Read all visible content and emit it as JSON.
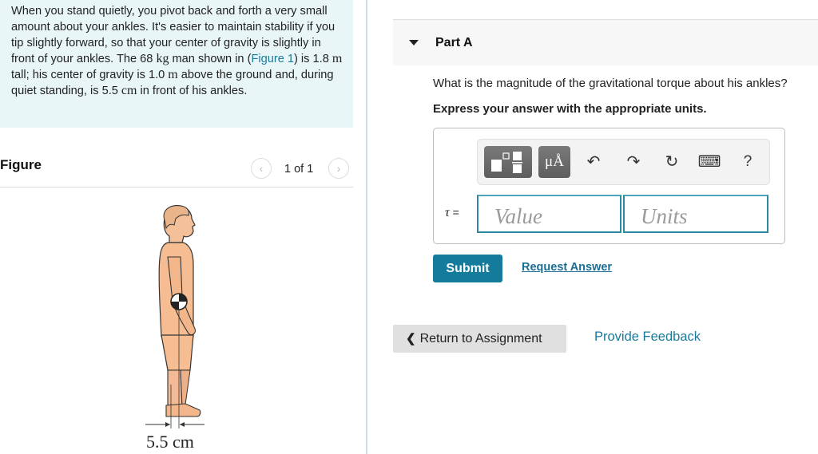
{
  "problem": {
    "segments": [
      {
        "text": "When you stand quietly, you pivot back and forth a very small amount about your ankles. It's easier to maintain stability if you tip slightly forward, so that your center of gravity is slightly in front of your ankles. The 68 ",
        "type": "text"
      },
      {
        "text": "kg",
        "type": "math"
      },
      {
        "text": " man shown in (",
        "type": "text"
      },
      {
        "text": "Figure 1",
        "type": "link"
      },
      {
        "text": ") is 1.8 ",
        "type": "text"
      },
      {
        "text": "m",
        "type": "math"
      },
      {
        "text": " tall; his center of gravity is 1.0 ",
        "type": "text"
      },
      {
        "text": "m",
        "type": "math"
      },
      {
        "text": " above the ground and, during quiet standing, is 5.5 ",
        "type": "text"
      },
      {
        "text": "cm",
        "type": "math"
      },
      {
        "text": " in front of his ankles.",
        "type": "text"
      }
    ]
  },
  "figure_panel": {
    "title": "Figure",
    "prev_icon": "‹",
    "next_icon": "›",
    "page_indicator": "1 of 1",
    "caption": "5.5 cm"
  },
  "part": {
    "title": "Part A",
    "question": "What is the magnitude of the gravitational torque about his ankles?",
    "instruction": "Express your answer with the appropriate units."
  },
  "toolbar": {
    "units_label": "μÅ",
    "undo_icon": "↶",
    "redo_icon": "↷",
    "reset_icon": "↻",
    "keyboard_icon": "⌨",
    "help_label": "?"
  },
  "answer": {
    "variable_symbol": "τ",
    "equals": " =",
    "value_placeholder": "Value",
    "units_placeholder": "Units",
    "value": "",
    "units": ""
  },
  "actions": {
    "submit_label": "Submit",
    "request_answer_label": "Request Answer",
    "return_label": "Return to Assignment",
    "return_icon": "❮",
    "feedback_label": "Provide Feedback"
  },
  "colors": {
    "problem_bg": "#e8f6f8",
    "accent": "#147b9c",
    "link": "#1a7a9c",
    "input_border": "#2e8aa2"
  }
}
